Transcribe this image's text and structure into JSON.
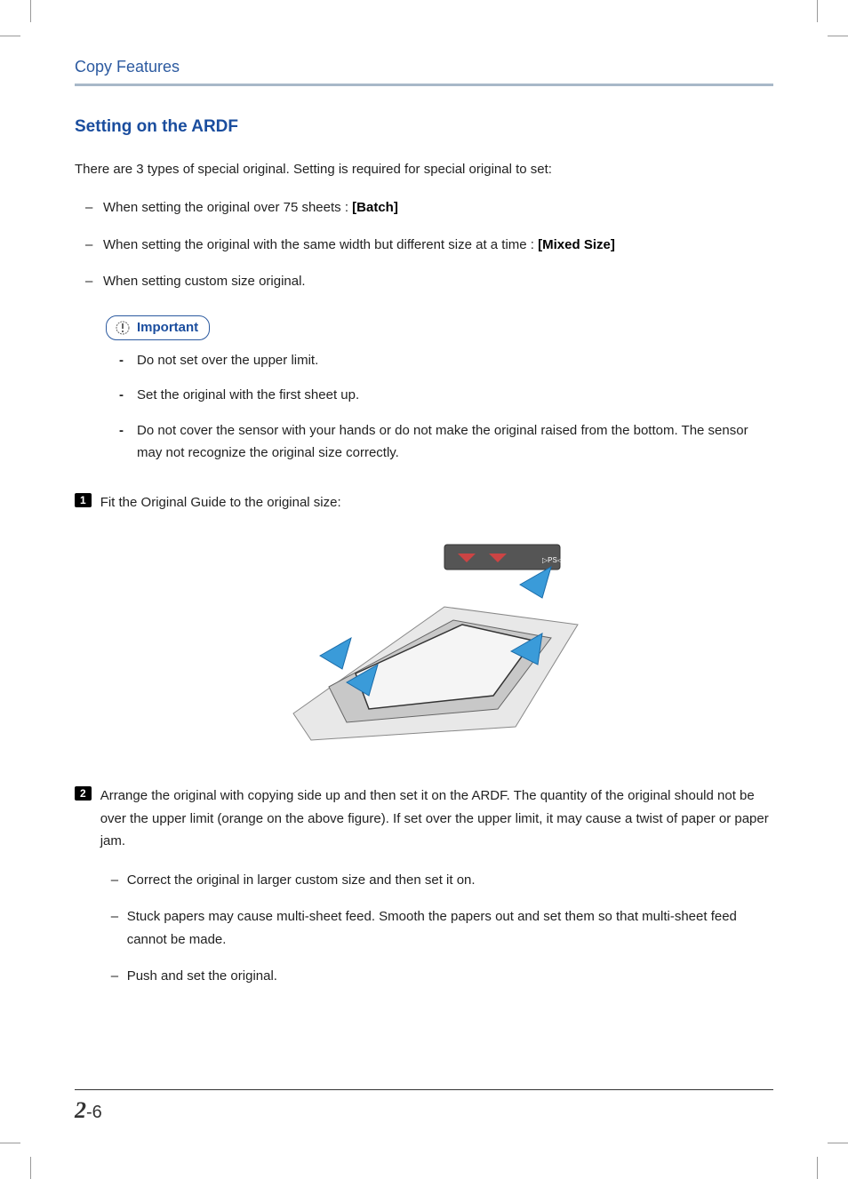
{
  "header": {
    "title": "Copy Features"
  },
  "section": {
    "title": "Setting on the ARDF"
  },
  "intro": "There are 3 types of special original. Setting is required for special original to set:",
  "type_bullets": [
    {
      "text": "When setting the original over 75 sheets : ",
      "bold": "[Batch]"
    },
    {
      "text": "When setting the original with the same width but different size at a time : ",
      "bold": "[Mixed Size]"
    },
    {
      "text": "When setting custom size original.",
      "bold": ""
    }
  ],
  "important": {
    "label": "Important",
    "items": [
      "Do not set over the upper limit.",
      "Set the original with the first sheet up.",
      "Do not cover the sensor with your hands or do not make the original raised from the bottom. The sensor may not recognize the original size correctly."
    ]
  },
  "steps": [
    {
      "num": "1",
      "text": "Fit the Original Guide to the original size:"
    },
    {
      "num": "2",
      "text": "Arrange the original with copying side up and then set it on the ARDF. The quantity of the original should not be over the upper limit (orange on the above figure). If set over the upper limit, it may cause a twist of paper or paper jam."
    }
  ],
  "step2_sub": [
    "Correct the original in larger custom size and then set it on.",
    "Stuck papers may cause multi-sheet feed. Smooth the papers out and set them so that multi-sheet feed cannot be made.",
    "Push and set the original."
  ],
  "page_number": {
    "chapter": "2",
    "sep": "-",
    "page": "6"
  }
}
